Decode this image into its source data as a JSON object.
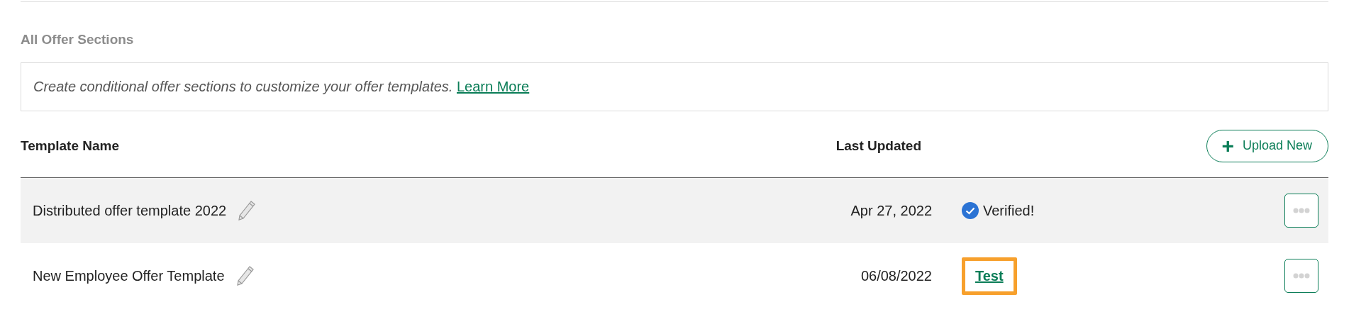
{
  "section": {
    "title": "All Offer Sections"
  },
  "info": {
    "text": "Create conditional offer sections to customize your offer templates.",
    "link": "Learn More"
  },
  "table": {
    "columns": [
      "Template Name",
      "Last Updated"
    ],
    "upload_button": {
      "icon": "+",
      "label": "Upload New"
    },
    "rows": [
      {
        "name": "Distributed offer template 2022",
        "updated": "Apr 27, 2022",
        "status": {
          "kind": "verified",
          "text": "Verified!",
          "highlighted": false
        },
        "shaded": true
      },
      {
        "name": "New Employee Offer Template",
        "updated": "06/08/2022",
        "status": {
          "kind": "link",
          "text": "Test",
          "highlighted": true
        },
        "shaded": false
      }
    ]
  }
}
